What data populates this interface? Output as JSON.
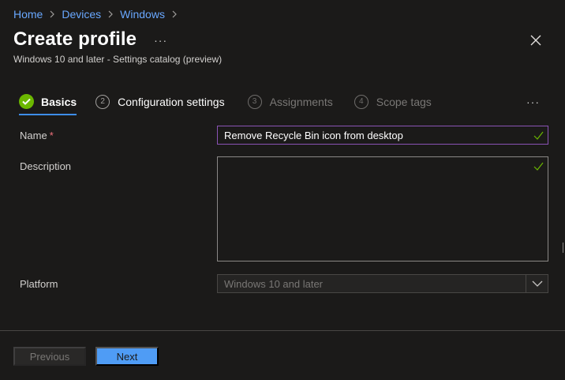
{
  "breadcrumb": {
    "items": [
      "Home",
      "Devices",
      "Windows"
    ]
  },
  "header": {
    "title": "Create profile",
    "more": "···",
    "subtitle": "Windows 10 and later - Settings catalog (preview)"
  },
  "steps": [
    {
      "num": "",
      "label": "Basics",
      "state": "completed-active"
    },
    {
      "num": "2",
      "label": "Configuration settings",
      "state": "current"
    },
    {
      "num": "3",
      "label": "Assignments",
      "state": "disabled"
    },
    {
      "num": "4",
      "label": "Scope tags",
      "state": "disabled"
    }
  ],
  "steps_more": "···",
  "form": {
    "name": {
      "label": "Name",
      "required_marker": "*",
      "value": "Remove Recycle Bin icon from desktop"
    },
    "description": {
      "label": "Description",
      "value": ""
    },
    "platform": {
      "label": "Platform",
      "value": "Windows 10 and later"
    }
  },
  "footer": {
    "previous_label": "Previous",
    "next_label": "Next"
  },
  "colors": {
    "accent": "#4f9cf5",
    "link": "#69a8ff",
    "success": "#6bb700",
    "focus_border": "#8a53b5",
    "required": "#f1707b"
  },
  "icons": {
    "close": "close-icon",
    "check": "checkmark-icon",
    "chevron": "chevron-down-icon",
    "breadcrumb_sep": "chevron-right-icon"
  }
}
